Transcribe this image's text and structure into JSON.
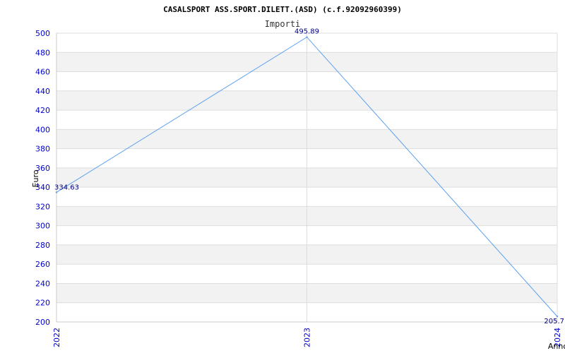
{
  "chart_data": {
    "type": "line",
    "title": "CASALSPORT ASS.SPORT.DILETT.(ASD) (c.f.92092960399)",
    "subtitle": "Importi",
    "xlabel": "Anno",
    "ylabel": "Euro",
    "categories": [
      "2022",
      "2023",
      "2024"
    ],
    "series": [
      {
        "values": [
          334.63,
          495.89,
          205.7
        ],
        "labels": [
          "334.63",
          "495.89",
          "205.7"
        ]
      }
    ],
    "ylim": [
      200,
      500
    ],
    "yticks": [
      200,
      220,
      240,
      260,
      280,
      300,
      320,
      340,
      360,
      380,
      400,
      420,
      440,
      460,
      480,
      500
    ],
    "grid": true,
    "legend": "none",
    "colors": {
      "line": "#5aa0f0",
      "band": "#f2f2f2",
      "gridline": "#dddddd",
      "tick_text": "#0000cc",
      "data_label": "#000080"
    }
  }
}
